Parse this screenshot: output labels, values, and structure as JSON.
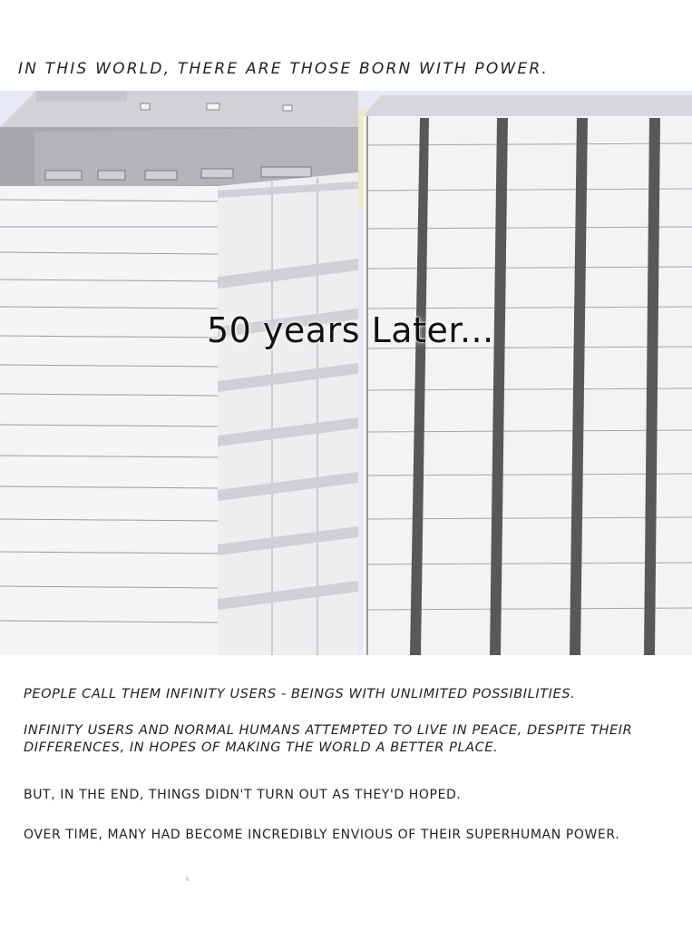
{
  "captions": {
    "top": "IN THIS WORLD, THERE ARE THOSE BORN WITH POWER.",
    "overlay": "50 years Later..."
  },
  "narration": [
    "PEOPLE CALL THEM INFINITY USERS - BEINGS WITH UNLIMITED POSSIBILITIES.",
    "INFINITY USERS AND NORMAL HUMANS ATTEMPTED TO LIVE IN PEACE, DESPITE THEIR DIFFERENCES, IN HOPES OF MAKING THE WORLD A BETTER PLACE.",
    "BUT, IN THE END, THINGS DIDN'T TURN OUT AS THEY'D HOPED.",
    "OVER TIME, MANY HAD BECOME INCREDIBLY ENVIOUS OF THEIR SUPERHUMAN POWER."
  ],
  "colors": {
    "sky": "#e7ebf7",
    "building_face": "#f4f4f6",
    "building_shade": "#dcdce0",
    "roof": "#b9b9bd",
    "pillar": "#5a5a5c",
    "line": "#9a9aa0"
  }
}
